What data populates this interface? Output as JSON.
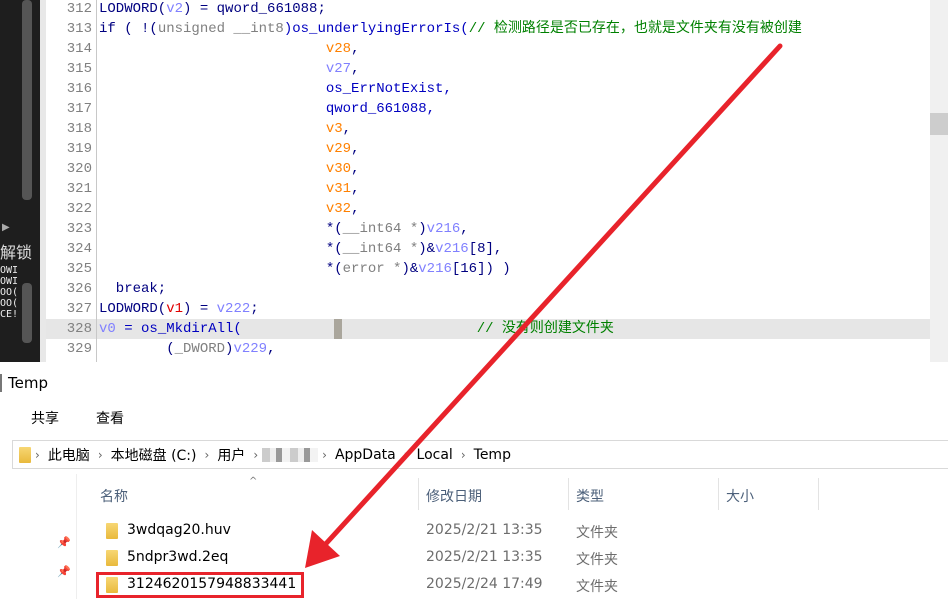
{
  "ida": {
    "left_panel": {
      "label": "解锁",
      "rows": [
        "OWI",
        "OWI",
        "OO(",
        "OO(",
        "CE!"
      ]
    },
    "lines": [
      {
        "num": "312",
        "tokens": [
          [
            "LODWORD(",
            "kw"
          ],
          [
            "v2",
            "var"
          ],
          [
            ") = qword_661088;",
            "kw"
          ]
        ]
      },
      {
        "num": "313",
        "tokens": [
          [
            "if ( !(",
            "kw"
          ],
          [
            "unsigned __int8",
            "gray"
          ],
          [
            ")os_underlyingErrorIs(",
            "fn"
          ],
          [
            "// 检测路径是否已存在，也就是文件夹有没有被创建",
            "cmt"
          ]
        ]
      },
      {
        "num": "314",
        "tokens": [
          [
            "                           ",
            ""
          ],
          [
            "v28",
            "arg"
          ],
          [
            ",",
            "kw"
          ]
        ]
      },
      {
        "num": "315",
        "tokens": [
          [
            "                           ",
            ""
          ],
          [
            "v27",
            "var"
          ],
          [
            ",",
            "kw"
          ]
        ]
      },
      {
        "num": "316",
        "tokens": [
          [
            "                           os_ErrNotExist,",
            "fn"
          ]
        ]
      },
      {
        "num": "317",
        "tokens": [
          [
            "                           qword_661088,",
            "fn"
          ]
        ]
      },
      {
        "num": "318",
        "tokens": [
          [
            "                           ",
            ""
          ],
          [
            "v3",
            "arg"
          ],
          [
            ",",
            "kw"
          ]
        ]
      },
      {
        "num": "319",
        "tokens": [
          [
            "                           ",
            ""
          ],
          [
            "v29",
            "arg"
          ],
          [
            ",",
            "kw"
          ]
        ]
      },
      {
        "num": "320",
        "tokens": [
          [
            "                           ",
            ""
          ],
          [
            "v30",
            "arg"
          ],
          [
            ",",
            "kw"
          ]
        ]
      },
      {
        "num": "321",
        "tokens": [
          [
            "                           ",
            ""
          ],
          [
            "v31",
            "arg"
          ],
          [
            ",",
            "kw"
          ]
        ]
      },
      {
        "num": "322",
        "tokens": [
          [
            "                           ",
            ""
          ],
          [
            "v32",
            "arg"
          ],
          [
            ",",
            "kw"
          ]
        ]
      },
      {
        "num": "323",
        "tokens": [
          [
            "                           *(",
            "kw"
          ],
          [
            "__int64 *",
            "gray"
          ],
          [
            ")",
            "kw"
          ],
          [
            "v216",
            "var"
          ],
          [
            ",",
            "kw"
          ]
        ]
      },
      {
        "num": "324",
        "tokens": [
          [
            "                           *(",
            "kw"
          ],
          [
            "__int64 *",
            "gray"
          ],
          [
            ")&",
            "kw"
          ],
          [
            "v216",
            "var"
          ],
          [
            "[8],",
            "kw"
          ]
        ]
      },
      {
        "num": "325",
        "tokens": [
          [
            "                           *(",
            "kw"
          ],
          [
            "error *",
            "gray"
          ],
          [
            ")&",
            "kw"
          ],
          [
            "v216",
            "var"
          ],
          [
            "[16]) )",
            "kw"
          ]
        ]
      },
      {
        "num": "326",
        "tokens": [
          [
            "  break;",
            "kw"
          ]
        ]
      },
      {
        "num": "327",
        "tokens": [
          [
            "LODWORD(",
            "kw"
          ],
          [
            "v1",
            "red"
          ],
          [
            ") = ",
            "kw"
          ],
          [
            "v222",
            "var"
          ],
          [
            ";",
            "kw"
          ]
        ]
      },
      {
        "num": "328",
        "highlight": true,
        "tokens": [
          [
            "v0",
            "var"
          ],
          [
            " = os_MkdirAll(",
            "fn"
          ],
          [
            "           ",
            ""
          ],
          [
            "CURSOR",
            ""
          ],
          [
            "                ",
            ""
          ],
          [
            "// 没有则创建文件夹",
            "cmt"
          ]
        ]
      },
      {
        "num": "329",
        "tokens": [
          [
            "        (",
            "kw"
          ],
          [
            "_DWORD",
            "gray"
          ],
          [
            ")",
            "kw"
          ],
          [
            "v229",
            "var"
          ],
          [
            ",",
            "kw"
          ]
        ]
      }
    ]
  },
  "explorer": {
    "title": "Temp",
    "ribbon_tabs": [
      "共享",
      "查看"
    ],
    "breadcrumb": [
      "此电脑",
      "本地磁盘 (C:)",
      "用户",
      "AppData",
      "Local",
      "Temp"
    ],
    "columns": [
      "名称",
      "修改日期",
      "类型",
      "大小"
    ],
    "files": [
      {
        "name": "3wdqag20.huv",
        "date": "2025/2/21 13:35",
        "type": "文件夹",
        "size": ""
      },
      {
        "name": "5ndpr3wd.2eq",
        "date": "2025/2/21 13:35",
        "type": "文件夹",
        "size": ""
      },
      {
        "name": "3124620157948833441",
        "date": "2025/2/24 17:49",
        "type": "文件夹",
        "size": ""
      }
    ]
  },
  "annotation": {
    "color": "#e8232b"
  }
}
